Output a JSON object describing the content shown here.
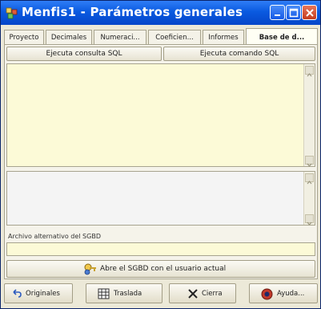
{
  "window": {
    "title": "Menfis1 - Parámetros generales"
  },
  "tabs": [
    {
      "label": "Proyecto",
      "active": false
    },
    {
      "label": "Decimales",
      "active": false
    },
    {
      "label": "Numeraci...",
      "active": false
    },
    {
      "label": "Coeficien...",
      "active": false
    },
    {
      "label": "Informes",
      "active": false
    },
    {
      "label": "Base de d...",
      "active": true
    }
  ],
  "sql": {
    "query_button": "Ejecuta consulta SQL",
    "command_button": "Ejecuta comando SQL",
    "query_text": "",
    "result_text": ""
  },
  "alt_file": {
    "label": "Archivo alternativo del SGBD",
    "value": ""
  },
  "open_button": "Abre el SGBD con el usuario actual",
  "bottom_buttons": {
    "originals": "Originales",
    "transfer": "Traslada",
    "close": "Cierra",
    "help": "Ayuda..."
  },
  "colors": {
    "titlebar": "#0a5ae0",
    "panel": "#ece9d8",
    "field_bg": "#fcfad7"
  },
  "icons": [
    "app-icon",
    "minimize-icon",
    "maximize-icon",
    "close-icon",
    "key-user-icon",
    "undo-icon",
    "grid-icon",
    "x-icon",
    "help-icon"
  ]
}
